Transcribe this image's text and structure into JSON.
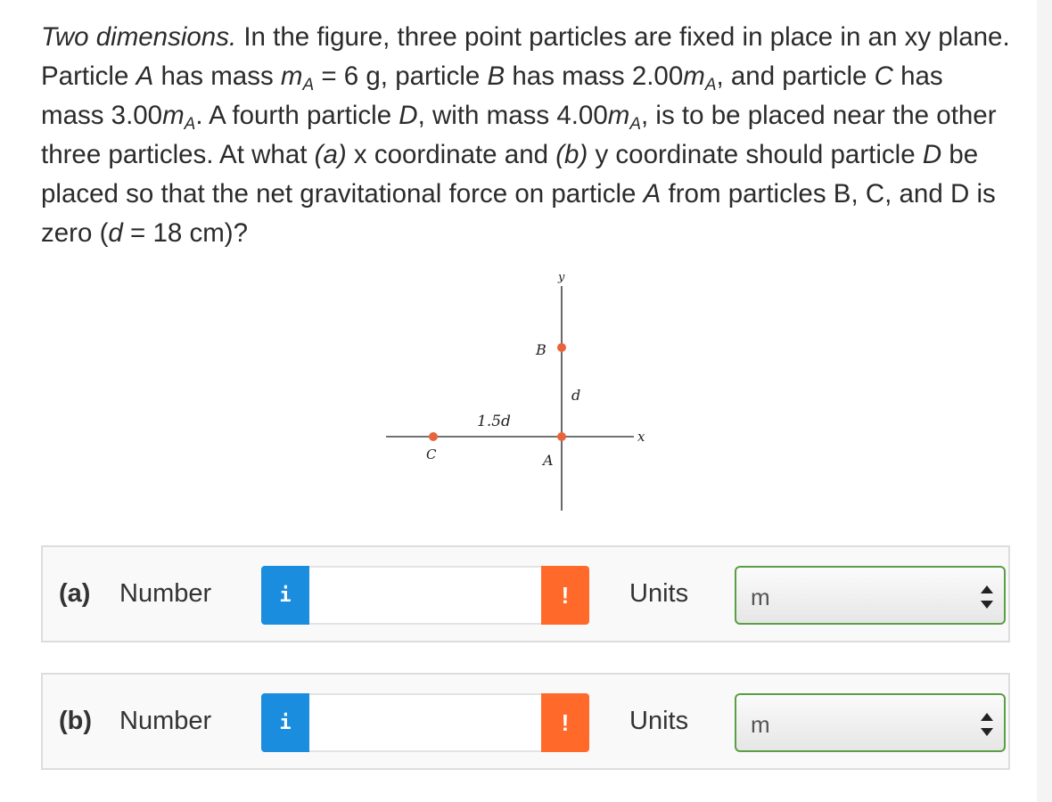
{
  "question": {
    "lead": "Two dimensions.",
    "t1": " In the figure, three point particles are fixed in place in an xy plane. Particle ",
    "A1": "A",
    "t2": " has mass ",
    "m1": "m",
    "sub1": "A",
    "t3": " = 6 g, particle ",
    "B1": "B",
    "t4": " has mass 2.00",
    "m2": "m",
    "sub2": "A",
    "t5": ", and particle ",
    "C1": "C",
    "t6": " has mass 3.00",
    "m3": "m",
    "sub3": "A",
    "t7": ". A fourth particle ",
    "D1": "D",
    "t8": ", with mass 4.00",
    "m4": "m",
    "sub4": "A",
    "t9": ", is to be placed near the other three particles. At what ",
    "pa": "(a)",
    "t10": " x coordinate and ",
    "pb": "(b)",
    "t11": " y coordinate should particle ",
    "D2": "D",
    "t12": " be placed so that the net gravitational force on particle ",
    "A2": "A",
    "t13": " from particles B, C, and D is zero (",
    "dvar": "d",
    "t14": " = 18 cm)?"
  },
  "figure": {
    "y_axis_label": "y",
    "x_axis_label": "x",
    "label_a": "A",
    "label_b": "B",
    "label_c": "C",
    "label_d": "d",
    "label_15d": "1.5d",
    "particle_color": "#e8643c"
  },
  "answers": [
    {
      "part": "(a)",
      "number_label": "Number",
      "info": "i",
      "value": "",
      "warn": "!",
      "units_label": "Units",
      "unit": "m"
    },
    {
      "part": "(b)",
      "number_label": "Number",
      "info": "i",
      "value": "",
      "warn": "!",
      "units_label": "Units",
      "unit": "m"
    }
  ],
  "colors": {
    "info": "#1a8ddf",
    "warn": "#ff6a2b",
    "select_border": "#5a9e45"
  }
}
